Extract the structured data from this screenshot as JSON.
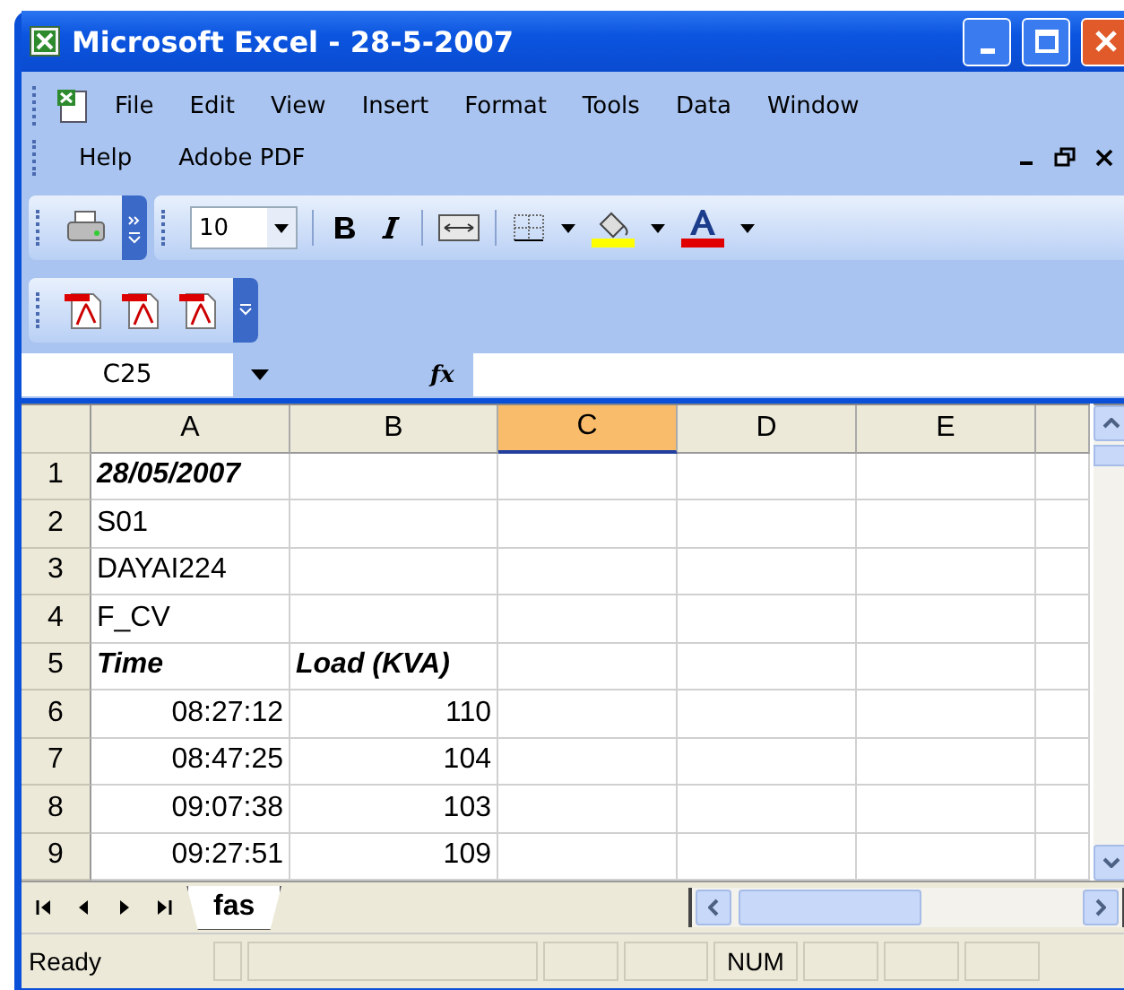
{
  "window": {
    "title": "Microsoft Excel - 28-5-2007"
  },
  "menu": [
    {
      "label": "File"
    },
    {
      "label": "Edit"
    },
    {
      "label": "View"
    },
    {
      "label": "Insert"
    },
    {
      "label": "Format"
    },
    {
      "label": "Tools"
    },
    {
      "label": "Data"
    },
    {
      "label": "Window"
    },
    {
      "label": "Help"
    },
    {
      "label": "Adobe PDF"
    }
  ],
  "toolbar": {
    "font_size": "10"
  },
  "formula_bar": {
    "name_box": "C25",
    "function_label": "fx"
  },
  "columns": [
    {
      "label": "A",
      "selected": false
    },
    {
      "label": "B",
      "selected": false
    },
    {
      "label": "C",
      "selected": true
    },
    {
      "label": "D",
      "selected": false
    },
    {
      "label": "E",
      "selected": false
    }
  ],
  "rows": [
    {
      "number": "1",
      "cells": [
        {
          "text": "28/05/2007",
          "kind": "heading"
        }
      ]
    },
    {
      "number": "2",
      "cells": [
        {
          "text": "S01",
          "kind": "text"
        }
      ]
    },
    {
      "number": "3",
      "cells": [
        {
          "text": "DAYAI224",
          "kind": "text"
        }
      ]
    },
    {
      "number": "4",
      "cells": [
        {
          "text": "F_CV",
          "kind": "text"
        }
      ]
    },
    {
      "number": "5",
      "cells": [
        {
          "text": "Time",
          "kind": "heading"
        },
        {
          "text": "Load (KVA)",
          "kind": "heading"
        }
      ]
    },
    {
      "number": "6",
      "cells": [
        {
          "text": "08:27:12",
          "kind": "number"
        },
        {
          "text": "110",
          "kind": "number"
        }
      ]
    },
    {
      "number": "7",
      "cells": [
        {
          "text": "08:47:25",
          "kind": "number"
        },
        {
          "text": "104",
          "kind": "number"
        }
      ]
    },
    {
      "number": "8",
      "cells": [
        {
          "text": "09:07:38",
          "kind": "number"
        },
        {
          "text": "103",
          "kind": "number"
        }
      ]
    },
    {
      "number": "9",
      "cells": [
        {
          "text": "09:27:51",
          "kind": "number"
        },
        {
          "text": "109",
          "kind": "number"
        }
      ]
    }
  ],
  "sheet_tabs": [
    {
      "label": "fas",
      "selected": true
    }
  ],
  "status_bar": {
    "status": "Ready",
    "indicator": "NUM"
  }
}
